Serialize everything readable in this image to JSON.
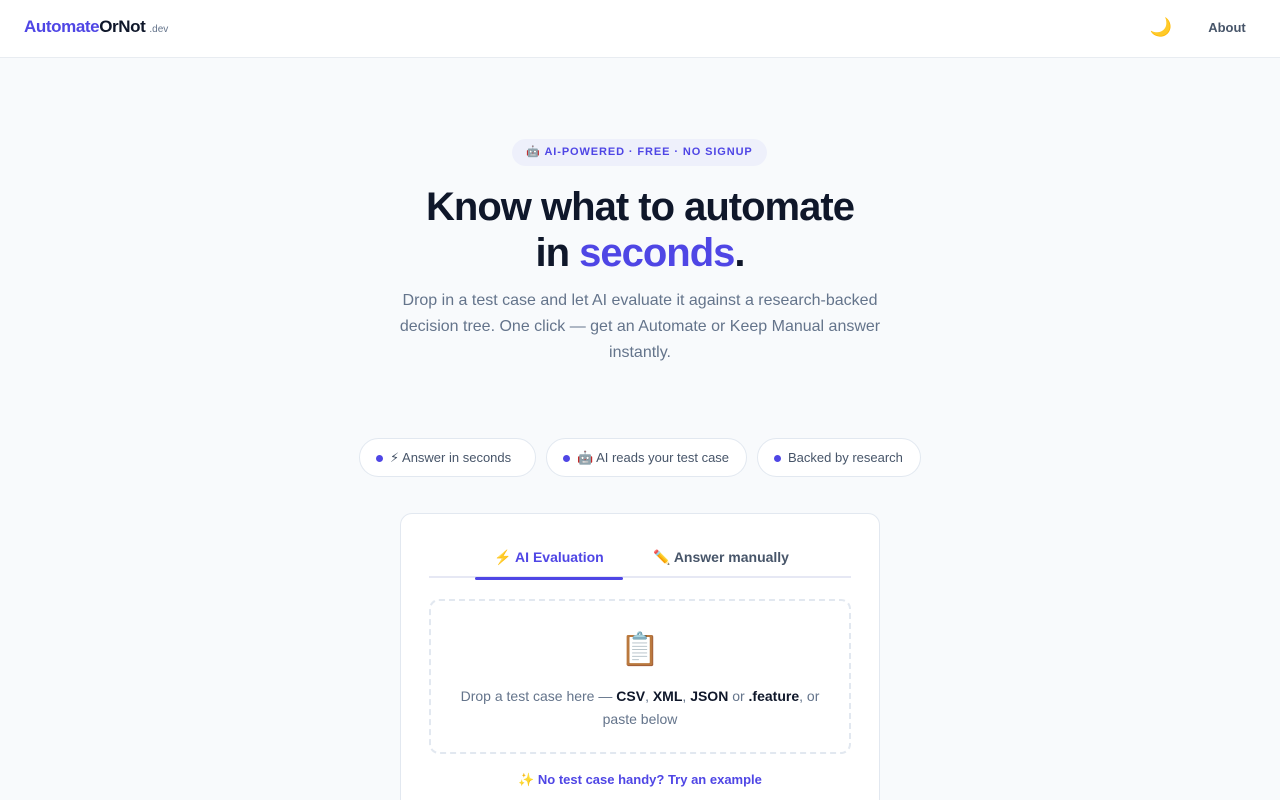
{
  "header": {
    "logo": {
      "part1": "Automate",
      "part2": "OrNot",
      "suffix": ".dev"
    },
    "theme_toggle_icon": "moon-icon",
    "theme_toggle_glyph": "🌙",
    "nav": {
      "about": "About"
    }
  },
  "hero": {
    "badge": "🤖 AI-POWERED · FREE · NO SIGNUP",
    "title_line1": "Know what to automate",
    "title_line2_prefix": "in ",
    "title_accent": "seconds",
    "title_period": ".",
    "subtitle": "Drop in a test case and let AI evaluate it against a research-backed decision tree. One click — get an Automate or Keep Manual answer instantly."
  },
  "chips": [
    {
      "label": "⚡ Answer in seconds"
    },
    {
      "label": "🤖 AI reads your test case"
    },
    {
      "label": "Backed by research"
    }
  ],
  "card": {
    "tabs": [
      {
        "label": "⚡ AI Evaluation",
        "active": true
      },
      {
        "label": "✏️ Answer manually",
        "active": false
      }
    ],
    "dropzone": {
      "icon": "clipboard-icon",
      "glyph": "📋",
      "text_prefix": "Drop a test case here — ",
      "formats": [
        "CSV",
        "XML",
        "JSON",
        ".feature"
      ],
      "sep1": ", ",
      "sep2": ", ",
      "sep3": " or ",
      "text_suffix": ", or paste below"
    },
    "example_link": "✨ No test case handy? Try an example"
  },
  "colors": {
    "accent": "#4f46e5",
    "text_dark": "#0f172a",
    "text_muted": "#64748b",
    "background": "#f8fafc"
  }
}
